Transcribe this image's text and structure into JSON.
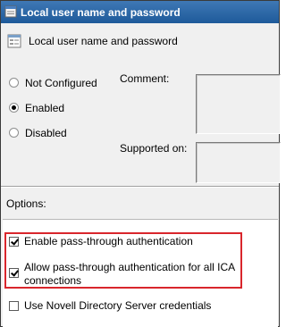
{
  "window": {
    "title": "Local user name and password"
  },
  "policy": {
    "heading": "Local user name and password"
  },
  "state": {
    "options": [
      {
        "label": "Not Configured",
        "selected": false
      },
      {
        "label": "Enabled",
        "selected": true
      },
      {
        "label": "Disabled",
        "selected": false
      }
    ]
  },
  "fields": {
    "comment_label": "Comment:",
    "supported_label": "Supported on:"
  },
  "options_section": {
    "label": "Options:",
    "checkboxes": [
      {
        "label": "Enable pass-through authentication",
        "checked": true
      },
      {
        "label_line1": "Allow pass-through authentication for all ICA",
        "label_line2": "connections",
        "checked": true
      },
      {
        "label": "Use Novell Directory Server credentials",
        "checked": false
      }
    ]
  },
  "colors": {
    "titlebar": "#2a66a6",
    "highlight_border": "#d9262c",
    "dialog_bg": "#f0f0f0"
  },
  "icons": {
    "title": "policy-setting-icon",
    "heading": "policy-setting-icon"
  }
}
